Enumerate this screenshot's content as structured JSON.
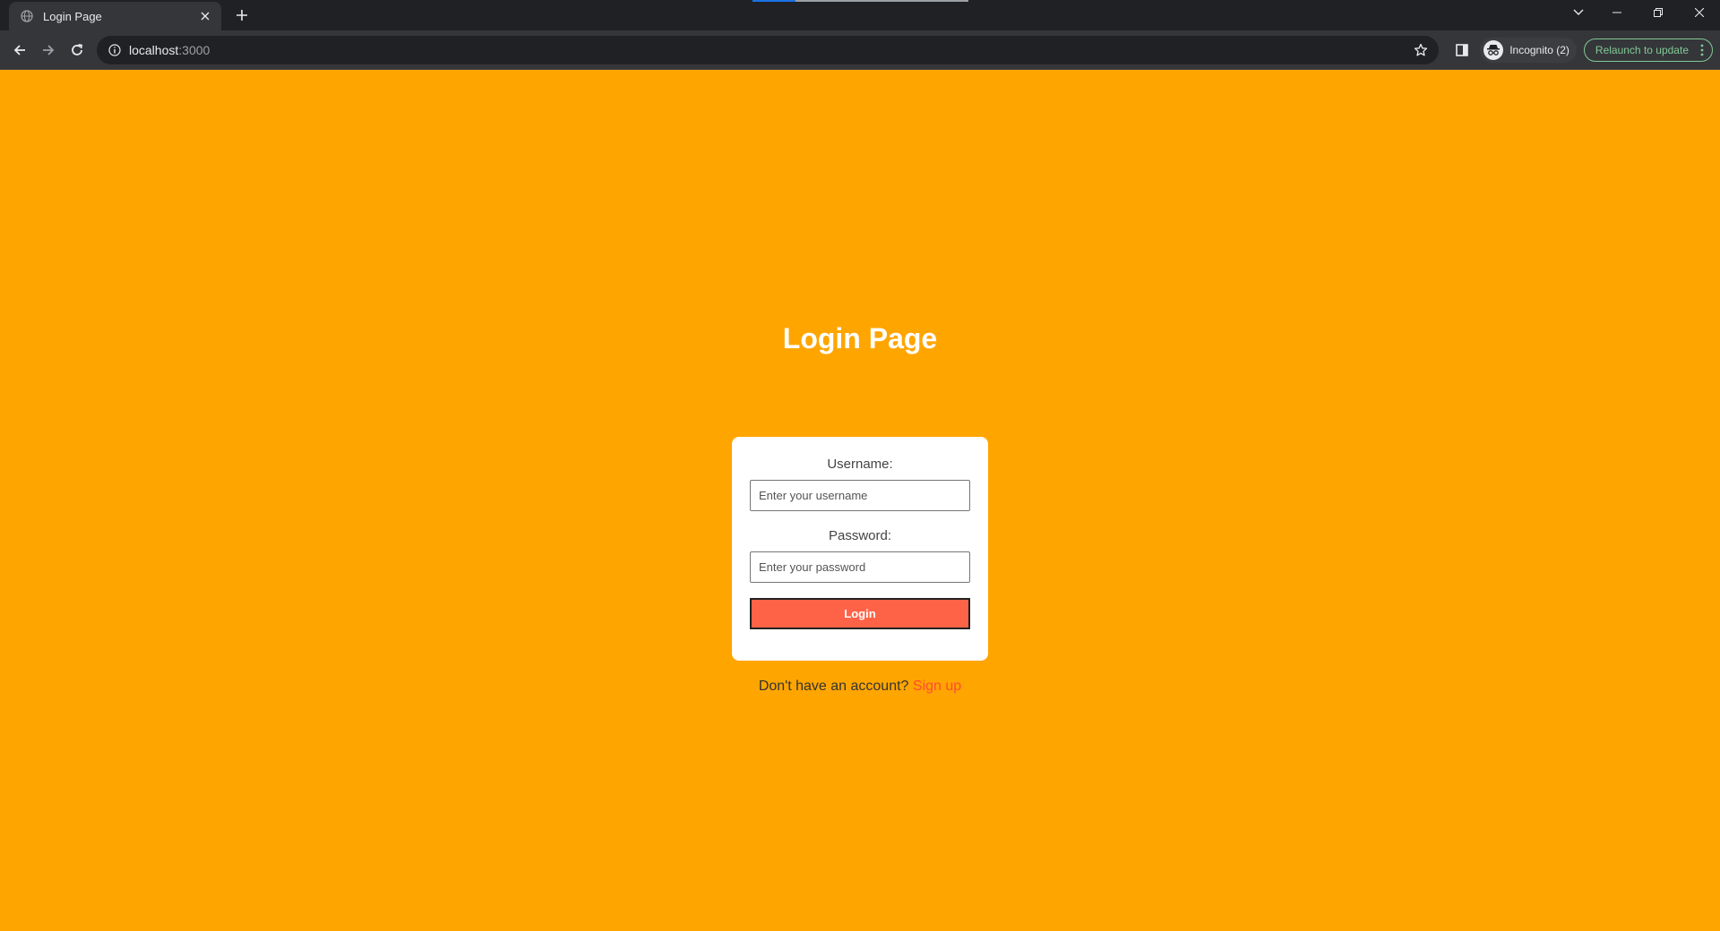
{
  "browser": {
    "tab": {
      "title": "Login Page"
    },
    "address_bar": {
      "host": "localhost",
      "port": ":3000"
    },
    "profile": {
      "label": "Incognito (2)"
    },
    "update_button": {
      "label": "Relaunch to update"
    },
    "colors": {
      "chrome_dark": "#202124",
      "chrome_toolbar": "#35363a",
      "update_green": "#81c995"
    }
  },
  "page": {
    "title": "Login Page",
    "background_color": "#ffa500",
    "form": {
      "username": {
        "label": "Username:",
        "placeholder": "Enter your username",
        "value": ""
      },
      "password": {
        "label": "Password:",
        "placeholder": "Enter your password",
        "value": ""
      },
      "submit_label": "Login",
      "submit_color": "#ff6347"
    },
    "signup": {
      "prompt": "Don't have an account?",
      "link_label": "Sign up"
    }
  }
}
